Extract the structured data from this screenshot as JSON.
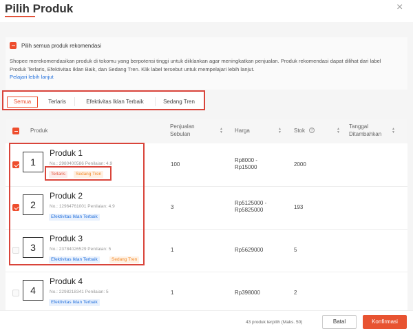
{
  "dialog": {
    "title": "Pilih Produk",
    "close_icon": "×"
  },
  "recommendation": {
    "select_all_label": "Pilih semua produk rekomendasi",
    "description": "Shopee merekomendasikan produk di tokomu yang berpotensi tinggi untuk diiklankan agar meningkatkan penjualan. Produk rekomendasi dapat dilihat dari label Produk Terlaris, Efektivitas Iklan Baik, dan Sedang Tren. Klik label tersebut untuk mempelajari lebih lanjut.",
    "learn_more": "Pelajari lebih lanjut"
  },
  "tabs": [
    {
      "label": "Semua",
      "active": true
    },
    {
      "label": "Terlaris",
      "active": false
    },
    {
      "label": "Efektivitas Iklan Terbaik",
      "active": false
    },
    {
      "label": "Sedang Tren",
      "active": false
    }
  ],
  "table": {
    "headers": {
      "product": "Produk",
      "sales": "Penjualan",
      "sales2": "Sebulan",
      "price": "Harga",
      "stock": "Stok",
      "date": "Tanggal",
      "date2": "Ditambahkan"
    },
    "rows": [
      {
        "number": "1",
        "name": "Produk 1",
        "meta": "No.: 2980400586   Penilaian: 4.9",
        "tags": [
          "Terlaris",
          "Sedang Tren"
        ],
        "sales": "100",
        "price": "Rp8000 -",
        "price2": "Rp15000",
        "stock": "2000",
        "checked": true
      },
      {
        "number": "2",
        "name": "Produk 2",
        "meta": "No.: 12964761001   Penilaian: 4.9",
        "tags": [
          "Efektivitas Iklan Terbaik"
        ],
        "sales": "3",
        "price": "Rp5125000 -",
        "price2": "Rp5825000",
        "stock": "193",
        "checked": true
      },
      {
        "number": "3",
        "name": "Produk 3",
        "meta": "No.: 23784026529   Penilaian: 5",
        "tags": [
          "Efektivitas Iklan Terbaik",
          "Sedang Tren"
        ],
        "sales": "1",
        "price": "Rp5629000",
        "price2": "",
        "stock": "5",
        "checked": false
      },
      {
        "number": "4",
        "name": "Produk 4",
        "meta": "No.: 2298218341   Penilaian: 5",
        "tags": [
          "Efektivitas Iklan Terbaik"
        ],
        "sales": "1",
        "price": "Rp398000",
        "price2": "",
        "stock": "2",
        "checked": false
      }
    ]
  },
  "footer": {
    "selected_text": "43 produk terpilih (Maks. 50)",
    "cancel": "Batal",
    "confirm": "Konfirmasi"
  },
  "colors": {
    "accent": "#ee4d2d",
    "highlight": "#d9443a",
    "link": "#2673dd"
  }
}
